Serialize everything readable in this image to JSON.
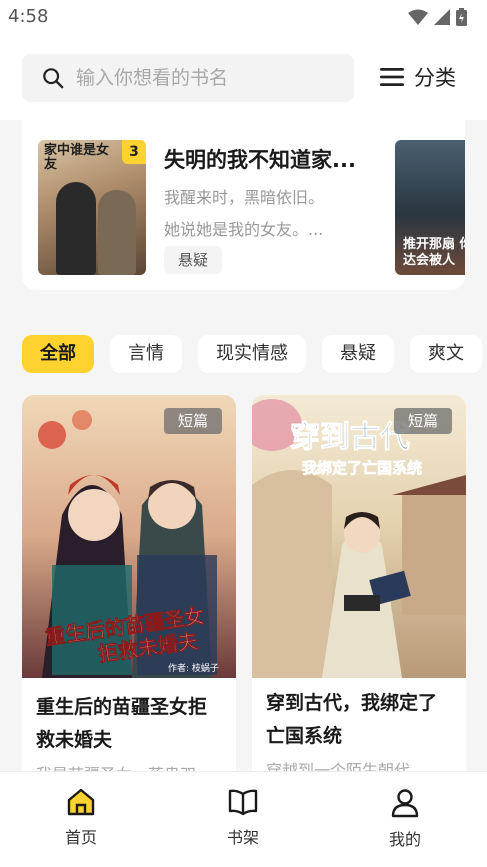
{
  "status": {
    "time": "4:58"
  },
  "search": {
    "placeholder": "输入你想看的书名"
  },
  "header": {
    "category_label": "分类"
  },
  "recommend": {
    "badge": "3",
    "title": "失明的我不知道家...",
    "line1": "我醒来时，黑暗依旧。",
    "line2": "她说她是我的女友。...",
    "tag": "悬疑",
    "cover_text": "家中谁是女友",
    "cover_b_text": "推开那扇 你达会被人"
  },
  "tabs": [
    "全部",
    "言情",
    "现实情感",
    "悬疑",
    "爽文"
  ],
  "books": [
    {
      "tag": "短篇",
      "cover_text": "重生后的苗疆圣女 拒救未婚夫",
      "cover_author": "作者: 枝蜗子",
      "title": "重生后的苗疆圣女拒救未婚夫",
      "desc": "我是苗疆圣女，药蛊双..."
    },
    {
      "tag": "短篇",
      "cover_text": "穿到古代",
      "cover_sub": "我绑定了亡国系统",
      "title": "穿到古代，我绑定了亡国系统",
      "desc": "穿越到一个陌生朝代，..."
    }
  ],
  "nav": [
    {
      "label": "首页",
      "icon": "home-icon"
    },
    {
      "label": "书架",
      "icon": "book-icon"
    },
    {
      "label": "我的",
      "icon": "user-icon"
    }
  ],
  "colors": {
    "accent": "#ffd22f",
    "background": "#f5f5f5"
  }
}
